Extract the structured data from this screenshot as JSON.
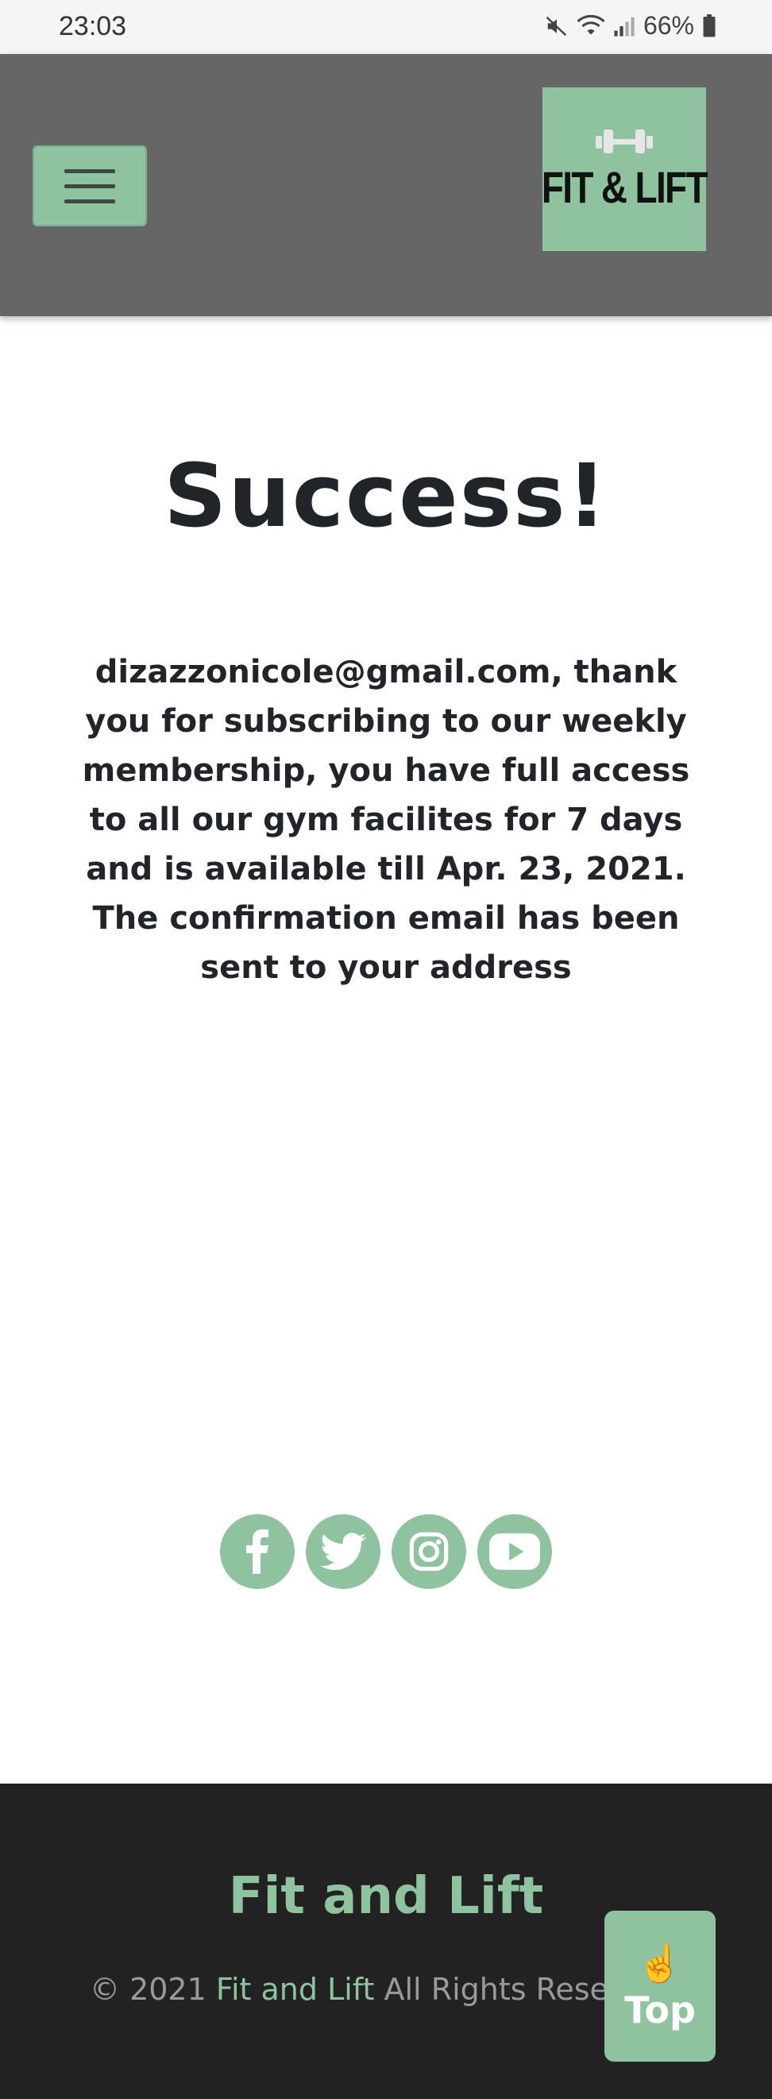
{
  "status_bar": {
    "time": "23:03",
    "battery": "66%"
  },
  "header": {
    "logo_text": "FIT & LIFT",
    "menu_icon": "hamburger-icon"
  },
  "main": {
    "title": "Success!",
    "message": "dizazzonicole@gmail.com, thank you for subscribing to our weekly membership, you have full access to all our gym facilites for 7 days and is available till Apr. 23, 2021. The confirmation email has been sent to your address"
  },
  "social": {
    "icons": [
      "facebook-icon",
      "twitter-icon",
      "instagram-icon",
      "youtube-icon"
    ]
  },
  "footer": {
    "brand": "Fit and Lift",
    "copyright_prefix": "© 2021 ",
    "copyright_link": "Fit and Lift",
    "copyright_suffix": " All Rights Rese"
  },
  "top_button": {
    "emoji": "☝️",
    "label": "Top"
  },
  "colors": {
    "accent": "#8fc3a0",
    "header_bg": "#666666",
    "footer_bg": "#222222"
  }
}
